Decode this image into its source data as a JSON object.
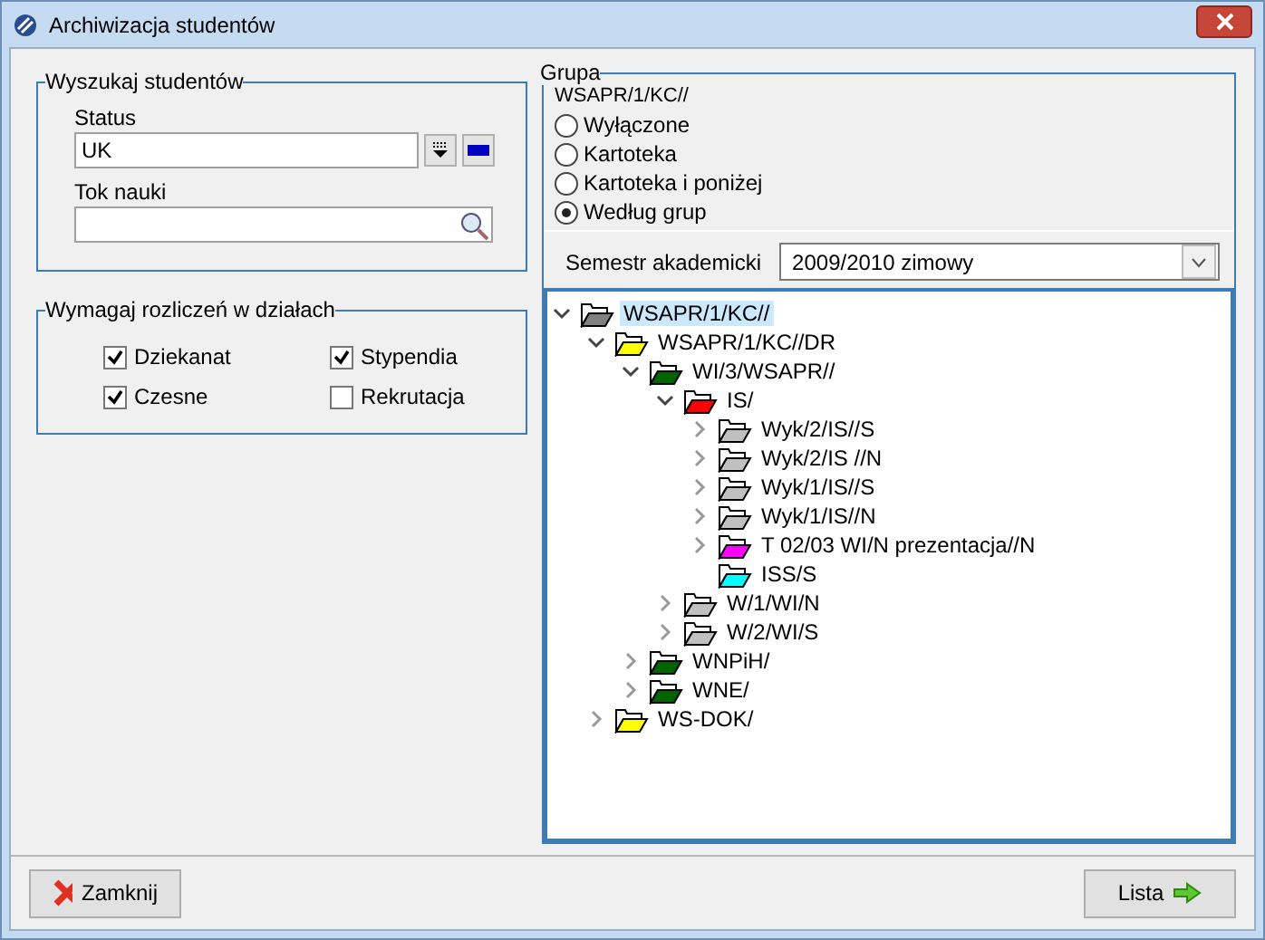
{
  "window": {
    "title": "Archiwizacja studentów"
  },
  "search": {
    "title": "Wyszukaj studentów",
    "status_label": "Status",
    "status_value": "UK",
    "tok_label": "Tok nauki"
  },
  "settlements": {
    "title": "Wymagaj rozliczeń w działach",
    "items": [
      {
        "label": "Dziekanat",
        "checked": true
      },
      {
        "label": "Stypendia",
        "checked": true
      },
      {
        "label": "Czesne",
        "checked": true
      },
      {
        "label": "Rekrutacja",
        "checked": false
      }
    ]
  },
  "group": {
    "title": "Grupa",
    "subtitle": "WSAPR/1/KC//",
    "options": [
      {
        "label": "Wyłączone",
        "selected": false
      },
      {
        "label": "Kartoteka",
        "selected": false
      },
      {
        "label": "Kartoteka i poniżej",
        "selected": false
      },
      {
        "label": "Według grup",
        "selected": true
      }
    ],
    "semester_label": "Semestr akademicki",
    "semester_value": "2009/2010 zimowy",
    "tree": [
      {
        "label": "WSAPR/1/KC//",
        "color": "#808080",
        "expandable": true,
        "expanded": true,
        "selected": true,
        "children": [
          {
            "label": "WSAPR/1/KC//DR",
            "color": "#ffff00",
            "expandable": true,
            "expanded": true,
            "selected": false,
            "children": [
              {
                "label": "WI/3/WSAPR//",
                "color": "#006400",
                "expandable": true,
                "expanded": true,
                "selected": false,
                "children": [
                  {
                    "label": "IS/",
                    "color": "#ff0000",
                    "expandable": true,
                    "expanded": true,
                    "selected": false,
                    "children": [
                      {
                        "label": "Wyk/2/IS//S",
                        "color": "#c0c0c0",
                        "expandable": true,
                        "expanded": false,
                        "selected": false
                      },
                      {
                        "label": "Wyk/2/IS //N",
                        "color": "#c0c0c0",
                        "expandable": true,
                        "expanded": false,
                        "selected": false
                      },
                      {
                        "label": "Wyk/1/IS//S",
                        "color": "#c0c0c0",
                        "expandable": true,
                        "expanded": false,
                        "selected": false
                      },
                      {
                        "label": "Wyk/1/IS//N",
                        "color": "#c0c0c0",
                        "expandable": true,
                        "expanded": false,
                        "selected": false
                      },
                      {
                        "label": "T 02/03 WI/N prezentacja//N",
                        "color": "#ff00ff",
                        "expandable": true,
                        "expanded": false,
                        "selected": false
                      },
                      {
                        "label": "ISS/S",
                        "color": "#00ffff",
                        "expandable": false,
                        "selected": false
                      }
                    ]
                  },
                  {
                    "label": "W/1/WI/N",
                    "color": "#c0c0c0",
                    "expandable": true,
                    "expanded": false,
                    "selected": false
                  },
                  {
                    "label": "W/2/WI/S",
                    "color": "#c0c0c0",
                    "expandable": true,
                    "expanded": false,
                    "selected": false
                  }
                ]
              },
              {
                "label": "WNPiH/",
                "color": "#006400",
                "expandable": true,
                "expanded": false,
                "selected": false
              },
              {
                "label": "WNE/",
                "color": "#006400",
                "expandable": true,
                "expanded": false,
                "selected": false
              }
            ]
          },
          {
            "label": "WS-DOK/",
            "color": "#ffff00",
            "expandable": true,
            "expanded": false,
            "selected": false
          }
        ]
      }
    ]
  },
  "buttons": {
    "close": "Zamknij",
    "list": "Lista"
  }
}
